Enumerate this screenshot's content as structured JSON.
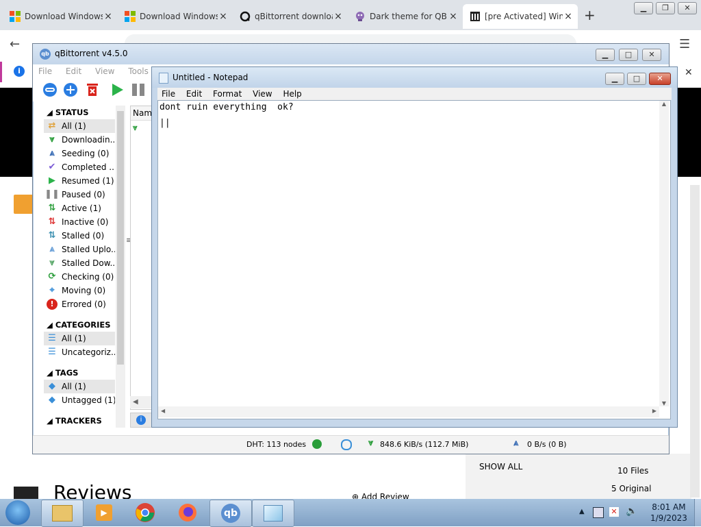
{
  "browser": {
    "tabs": [
      {
        "title": "Download Windows X",
        "icon": "windows-icon"
      },
      {
        "title": "Download Windows X",
        "icon": "windows-icon"
      },
      {
        "title": "qBittorrent downloa",
        "icon": "qbittorrent-site-icon"
      },
      {
        "title": "Dark theme for QBitt",
        "icon": "theme-icon"
      },
      {
        "title": "[pre Activated] Windo",
        "icon": "site-icon"
      }
    ],
    "page_bottom": {
      "heading": "Reviews",
      "show_all": "SHOW ALL",
      "files": "10 Files",
      "original": "5 Original",
      "add_review": "Add Review"
    }
  },
  "qbittorrent": {
    "title": "qBittorrent v4.5.0",
    "menu": [
      "File",
      "Edit",
      "View",
      "Tools"
    ],
    "status_header": "STATUS",
    "status_items": [
      {
        "label": "All (1)",
        "icon": "shuffle-icon",
        "color": "#e0a23a"
      },
      {
        "label": "Downloadin...",
        "icon": "download-icon",
        "color": "#2a9d3a"
      },
      {
        "label": "Seeding (0)",
        "icon": "upload-icon",
        "color": "#3d6fb6"
      },
      {
        "label": "Completed ...",
        "icon": "check-icon",
        "color": "#7b5bd6"
      },
      {
        "label": "Resumed (1)",
        "icon": "play-icon",
        "color": "#2bb34a"
      },
      {
        "label": "Paused (0)",
        "icon": "pause-icon",
        "color": "#888888"
      },
      {
        "label": "Active (1)",
        "icon": "active-arrows-icon",
        "color": "#2a9d3a"
      },
      {
        "label": "Inactive (0)",
        "icon": "inactive-arrows-icon",
        "color": "#d33"
      },
      {
        "label": "Stalled (0)",
        "icon": "stalled-arrows-icon",
        "color": "#3a8fb0"
      },
      {
        "label": "Stalled Uplo...",
        "icon": "stalled-upload-icon",
        "color": "#6aa0d8"
      },
      {
        "label": "Stalled Dow...",
        "icon": "stalled-download-icon",
        "color": "#5aa86a"
      },
      {
        "label": "Checking (0)",
        "icon": "refresh-icon",
        "color": "#2a9d3a"
      },
      {
        "label": "Moving (0)",
        "icon": "move-icon",
        "color": "#3a8fd8"
      },
      {
        "label": "Errored (0)",
        "icon": "error-icon",
        "color": "#d9241c"
      }
    ],
    "categories_header": "CATEGORIES",
    "category_items": [
      {
        "label": "All (1)",
        "icon": "list-icon"
      },
      {
        "label": "Uncategoriz...",
        "icon": "list-icon"
      }
    ],
    "tags_header": "TAGS",
    "tag_items": [
      {
        "label": "All (1)",
        "icon": "tag-icon"
      },
      {
        "label": "Untagged (1)",
        "icon": "tag-icon"
      }
    ],
    "trackers_header": "TRACKERS",
    "list_header": "Nam",
    "status_bar": {
      "dht": "DHT: 113 nodes",
      "download": "848.6 KiB/s (112.7 MiB)",
      "upload": "0 B/s (0 B)"
    }
  },
  "notepad": {
    "title": "Untitled - Notepad",
    "menu": [
      "File",
      "Edit",
      "Format",
      "View",
      "Help"
    ],
    "line1": "dont ruin everything  ok?",
    "line2": "||"
  },
  "taskbar": {
    "time": "8:01 AM",
    "date": "1/9/2023",
    "apps": [
      "start-orb-icon",
      "explorer-icon",
      "media-player-icon",
      "chrome-icon",
      "firefox-icon",
      "qbittorrent-icon",
      "notepad-icon"
    ]
  }
}
